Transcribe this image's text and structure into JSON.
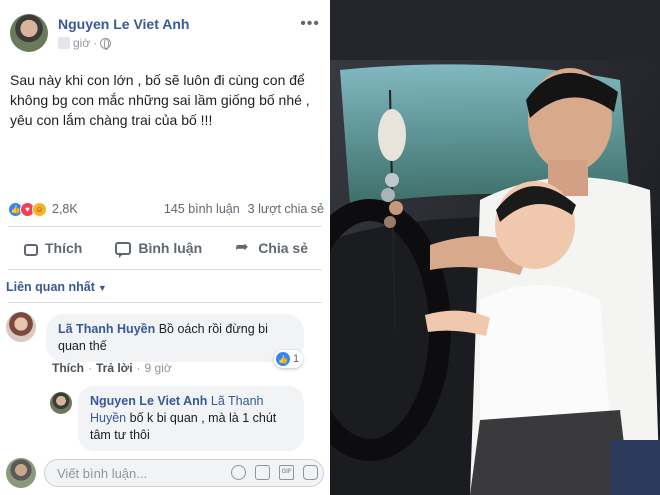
{
  "post": {
    "author": "Nguyen Le Viet Anh",
    "time_suffix": "giờ",
    "more_label": "•••",
    "text": "Sau này khi con lớn , bố sẽ luôn đi cùng con để\nkhông bg con mắc những sai lầm giống bố nhé ,\nyêu con lắm chàng trai của bố !!!",
    "reaction_count": "2,8K",
    "comments_count": "145 bình luận",
    "shares_count": "3 lượt chia sẻ",
    "actions": {
      "like": "Thích",
      "comment": "Bình luận",
      "share": "Chia sẻ"
    },
    "sort_label": "Liên quan nhất"
  },
  "comments": [
    {
      "author": "Lã Thanh Huyền",
      "text": "Bồ oách rồi đừng bi quan thế",
      "like_label": "Thích",
      "reply_label": "Trả lời",
      "time": "9 giờ",
      "likes": "1"
    },
    {
      "author": "Nguyen Le Viet Anh",
      "tagged": "Lã Thanh Huyền",
      "text": "bố k bi quan , mà là 1 chút tâm tư thôi"
    }
  ],
  "composer": {
    "placeholder": "Viết bình luận..."
  },
  "colors": {
    "link_blue": "#385898",
    "like_blue": "#2d88ff",
    "love_red": "#f33e58",
    "haha_yellow": "#f7b125"
  },
  "icons": [
    "globe-icon",
    "more-icon",
    "like-reaction-icon",
    "love-reaction-icon",
    "haha-reaction-icon",
    "thumb-up-icon",
    "comment-icon",
    "share-icon",
    "caret-down-icon",
    "emoji-icon",
    "camera-icon",
    "gif-icon",
    "sticker-icon"
  ]
}
